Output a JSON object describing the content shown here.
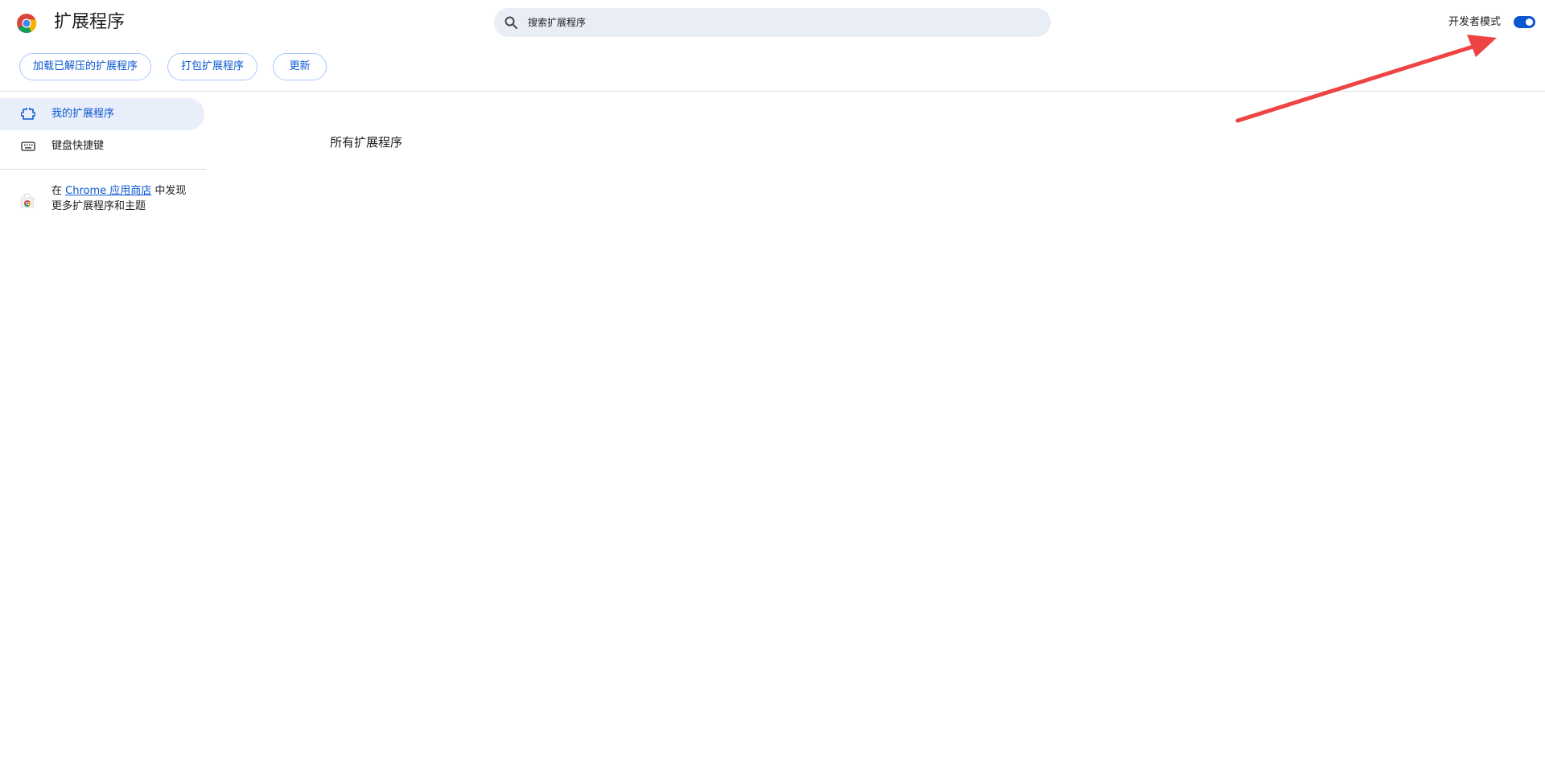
{
  "header": {
    "title": "扩展程序",
    "logo_icon": "chrome-logo-icon",
    "search": {
      "placeholder": "搜索扩展程序",
      "value": "",
      "icon": "search-icon"
    },
    "developer_mode": {
      "label": "开发者模式",
      "enabled": true
    }
  },
  "toolbar": {
    "load_unpacked_label": "加载已解压的扩展程序",
    "pack_label": "打包扩展程序",
    "update_label": "更新"
  },
  "sidebar": {
    "items": [
      {
        "label": "我的扩展程序",
        "icon": "puzzle-piece-icon",
        "active": true
      },
      {
        "label": "键盘快捷键",
        "icon": "keyboard-icon",
        "active": false
      }
    ],
    "store_promo": {
      "prefix": "在 ",
      "link_text": "Chrome 应用商店",
      "suffix": " 中发现更多扩展程序和主题",
      "icon": "chrome-web-store-icon"
    }
  },
  "main": {
    "section_title": "所有扩展程序"
  },
  "colors": {
    "accent": "#0b57d0",
    "search_bg": "#e9eef6",
    "active_nav_bg": "#e8eefa",
    "pill_border": "#a8c7fa",
    "annotation_arrow": "#ef4444"
  }
}
